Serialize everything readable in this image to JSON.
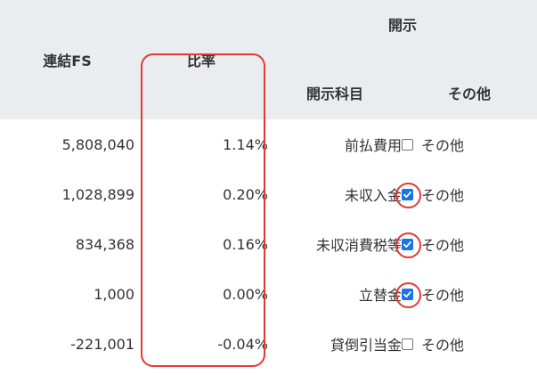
{
  "header": {
    "group_label": "開示",
    "col_fs": "連結FS",
    "col_ratio": "比率",
    "col_item": "開示科目",
    "col_other": "その他"
  },
  "rows": [
    {
      "fs": "5,808,040",
      "ratio": "1.14%",
      "item": "前払費用",
      "other_label": "その他",
      "checked": false
    },
    {
      "fs": "1,028,899",
      "ratio": "0.20%",
      "item": "未収入金",
      "other_label": "その他",
      "checked": true
    },
    {
      "fs": "834,368",
      "ratio": "0.16%",
      "item": "未収消費税等",
      "other_label": "その他",
      "checked": true
    },
    {
      "fs": "1,000",
      "ratio": "0.00%",
      "item": "立替金",
      "other_label": "その他",
      "checked": true
    },
    {
      "fs": "-221,001",
      "ratio": "-0.04%",
      "item": "貸倒引当金",
      "other_label": "その他",
      "checked": false
    }
  ],
  "colors": {
    "header_bg": "#eaedf0",
    "checkbox_checked": "#1a73e8",
    "annotation": "#e53935"
  }
}
